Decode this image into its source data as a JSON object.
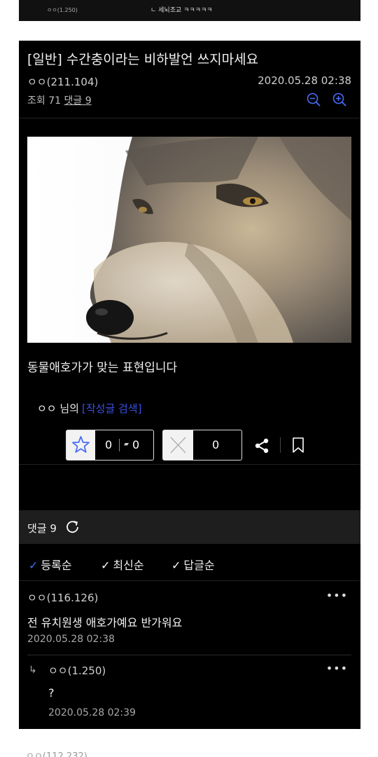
{
  "top_strip": {
    "author": "ㅇㅇ(1.250)",
    "comment": "ㄴ 세뇌조교 ㅋㅋㅋㅋㅋ"
  },
  "post": {
    "title": "[일반] 수간충이라는 비하발언 쓰지마세요",
    "author": "ㅇㅇ(211.104)",
    "date": "2020.05.28 02:38",
    "views_label": "조회 71",
    "comments_label": "댓글 9",
    "body": "동물애호가가 맞는 표현입니다",
    "by_prefix": "ㅇㅇ 님의",
    "search_label": "[작성글 검색]",
    "recommend_count": "0",
    "fixed_recommend_count": "0",
    "downvote_count": "0",
    "image": "wolf photo"
  },
  "comments_bar": {
    "label": "댓글 9"
  },
  "sort": [
    {
      "label": "등록순",
      "active": true
    },
    {
      "label": "최신순",
      "active": false
    },
    {
      "label": "답글순",
      "active": false
    }
  ],
  "comments": [
    {
      "author": "ㅇㅇ(116.126)",
      "text": "전 유치원생 애호가예요 반가워요",
      "date": "2020.05.28 02:38"
    },
    {
      "author": "ㅇㅇ(1.250)",
      "text": "?",
      "date": "2020.05.28 02:39",
      "reply": true
    }
  ],
  "next_comment_author": "ㅇㅇ(112.232)",
  "icons": {
    "more": "more-dots-icon",
    "accent": "#3f6df5",
    "search_color": "#3a4fe0"
  }
}
